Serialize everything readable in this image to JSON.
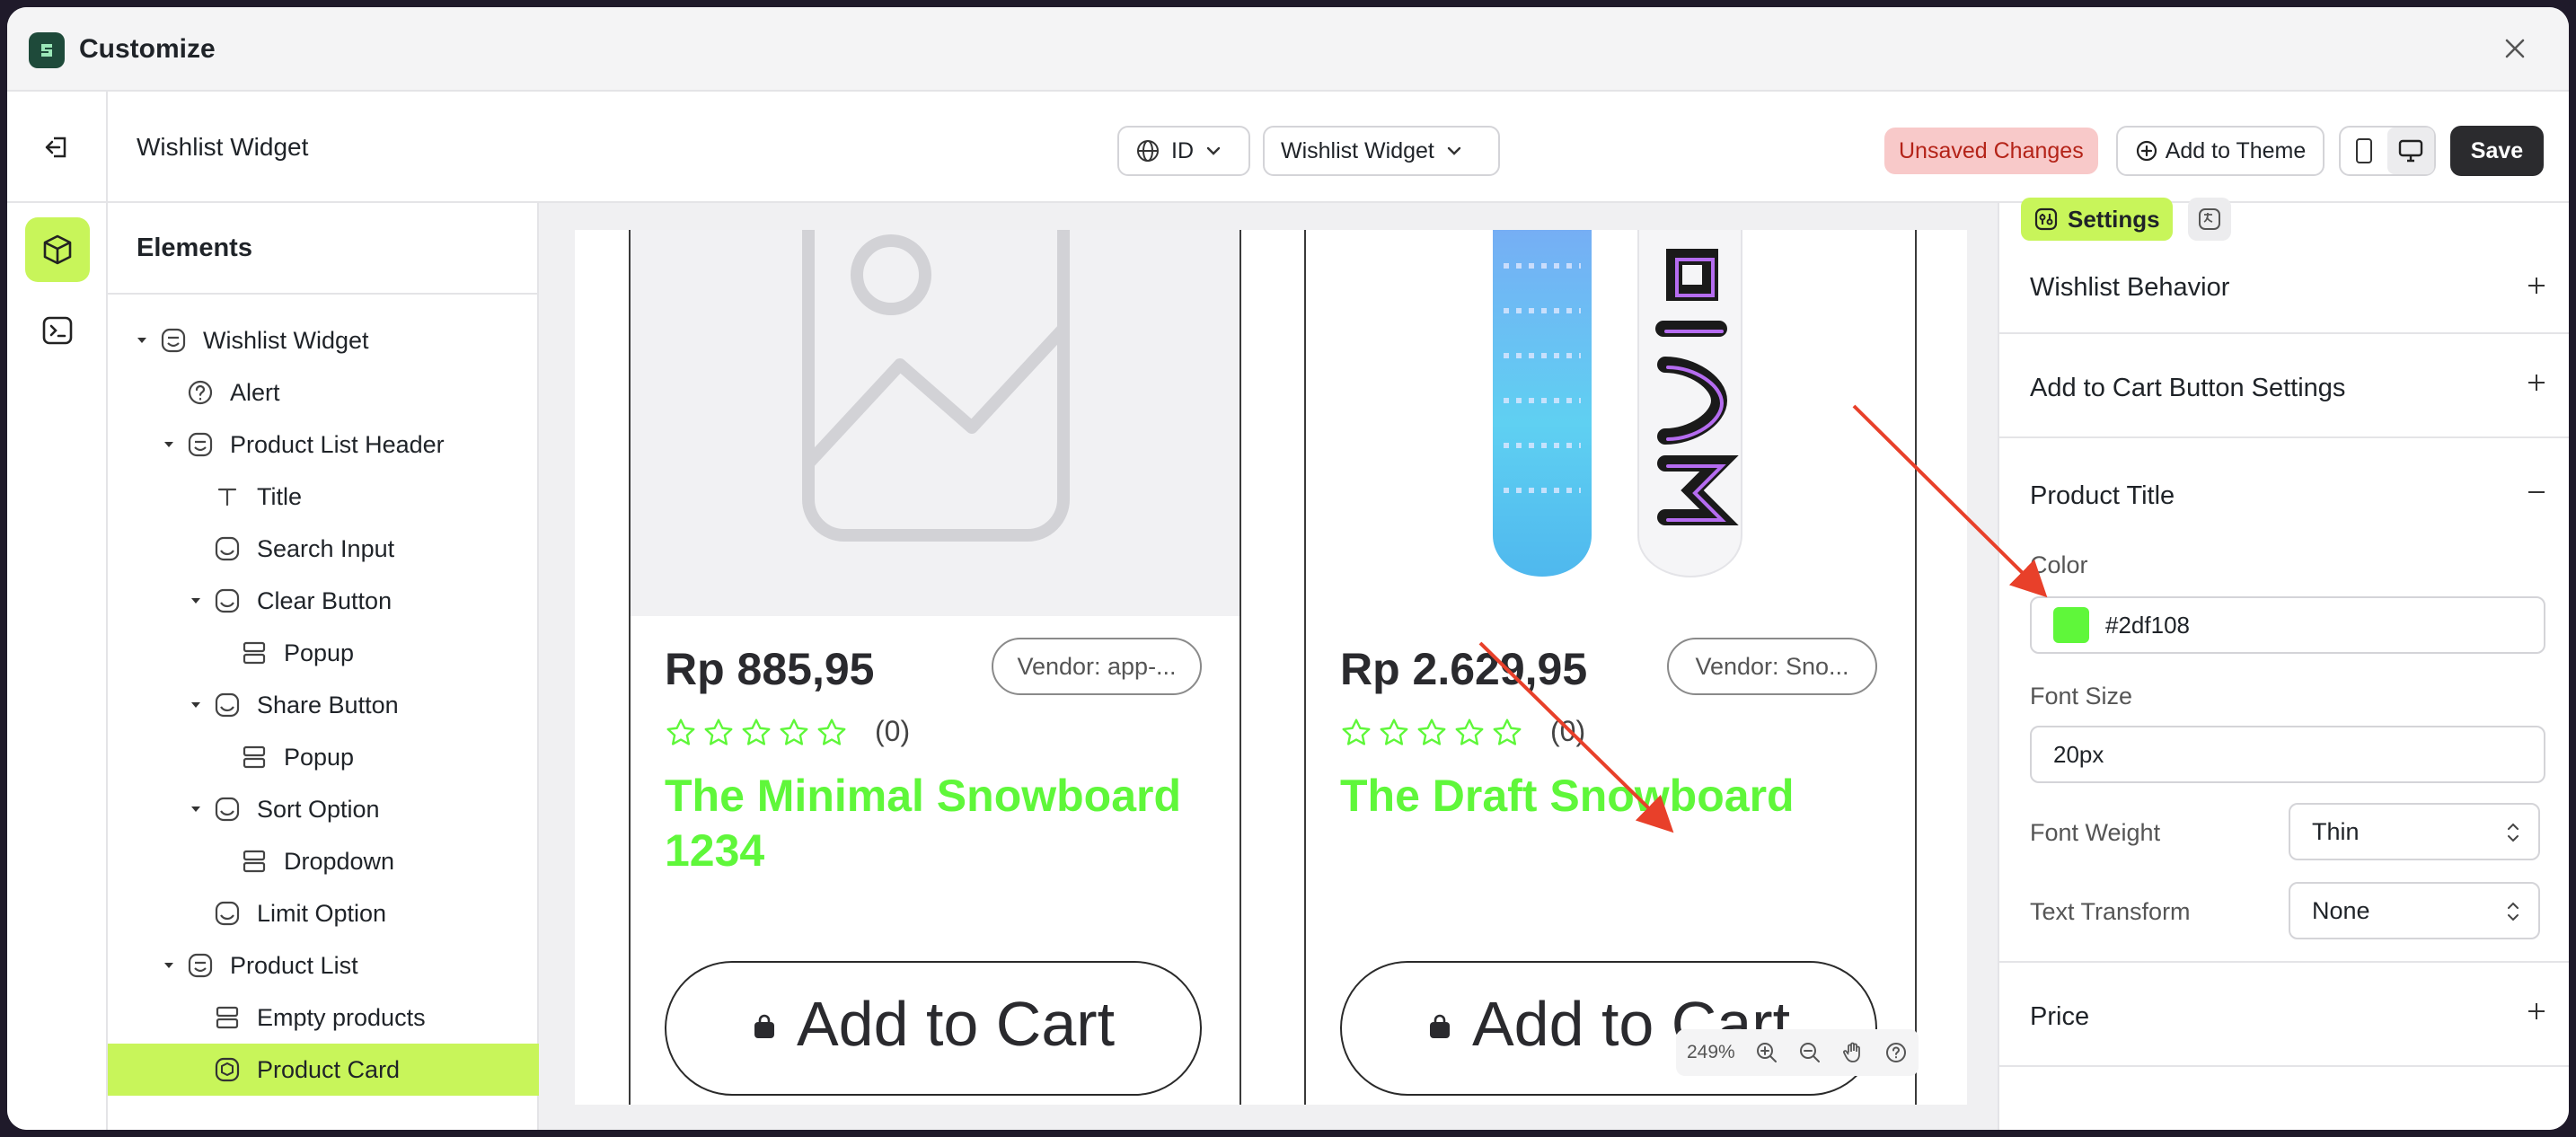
{
  "window": {
    "title": "Customize"
  },
  "topbar": {
    "title": "Wishlist Widget",
    "language": "ID",
    "template": "Wishlist Widget",
    "unsaved": "Unsaved Changes",
    "add_to_theme": "Add to Theme",
    "save": "Save"
  },
  "elements": {
    "title": "Elements",
    "items": [
      {
        "label": "Wishlist Widget"
      },
      {
        "label": "Alert"
      },
      {
        "label": "Product List Header"
      },
      {
        "label": "Title"
      },
      {
        "label": "Search Input"
      },
      {
        "label": "Clear Button"
      },
      {
        "label": "Popup"
      },
      {
        "label": "Share Button"
      },
      {
        "label": "Popup"
      },
      {
        "label": "Sort Option"
      },
      {
        "label": "Dropdown"
      },
      {
        "label": "Limit Option"
      },
      {
        "label": "Product List"
      },
      {
        "label": "Empty products"
      },
      {
        "label": "Product Card"
      }
    ]
  },
  "preview": {
    "cards": [
      {
        "price": "Rp 885,95",
        "vendor": "Vendor: app-...",
        "reviews": "(0)",
        "title": "The Minimal Snowboard 1234",
        "cta": "Add to Cart"
      },
      {
        "price": "Rp 2.629,95",
        "vendor": "Vendor: Sno...",
        "reviews": "(0)",
        "title": "The Draft Snowboard",
        "cta": "Add to Cart"
      }
    ],
    "zoom": "249%"
  },
  "settings": {
    "tab_settings": "Settings",
    "sections": {
      "wishlist_behavior": "Wishlist Behavior",
      "add_to_cart": "Add to Cart Button Settings",
      "product_title": "Product Title",
      "price": "Price"
    },
    "product_title": {
      "color_label": "Color",
      "color_value": "#2df108",
      "font_size_label": "Font Size",
      "font_size_value": "20px",
      "font_weight_label": "Font Weight",
      "font_weight_value": "Thin",
      "text_transform_label": "Text Transform",
      "text_transform_value": "None"
    }
  },
  "colors": {
    "accent": "#c8f55a",
    "title_green": "#5ff73a",
    "swatch": "#5ff73a",
    "unsaved_bg": "#f8c9c9",
    "unsaved_text": "#b42318",
    "arrow": "#e8402a"
  }
}
